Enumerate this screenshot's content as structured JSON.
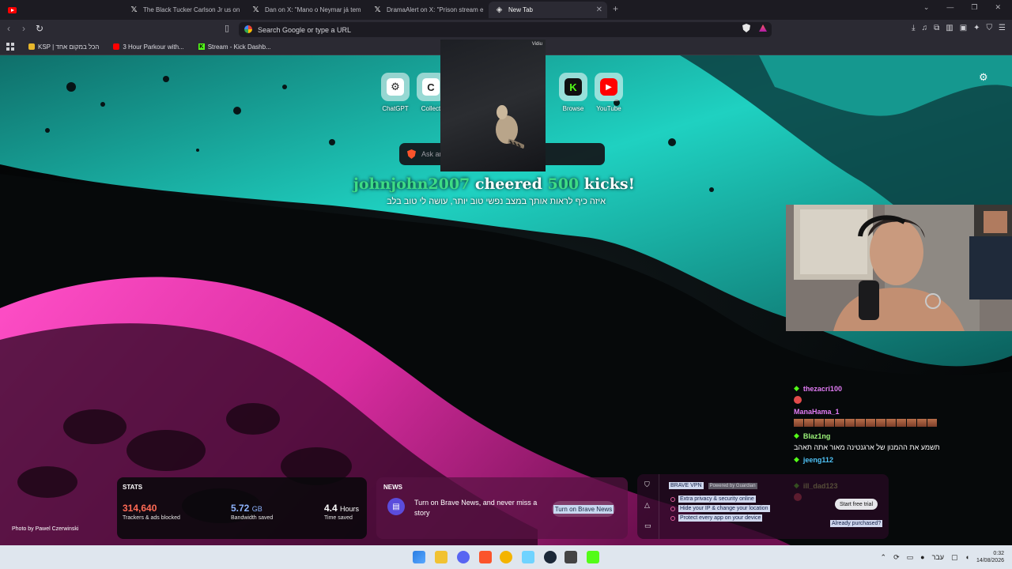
{
  "tabs": [
    {
      "title": "",
      "icon": "youtube-icon"
    },
    {
      "title": "The Black Tucker Carlson Jr us on X",
      "icon": "x-icon"
    },
    {
      "title": "Dan on X: \"Mano o Neymar já tem ta",
      "icon": "x-icon"
    },
    {
      "title": "DramaAlert on X: \"Prison stream end",
      "icon": "x-icon"
    },
    {
      "title": "New Tab",
      "icon": "brave-icon"
    }
  ],
  "omnibox": {
    "placeholder": "Search Google or type a URL"
  },
  "bookmarks": [
    {
      "label": "KSP | הכל במקום אחד",
      "icon": "ksp-icon"
    },
    {
      "label": "3 Hour Parkour with...",
      "icon": "youtube-icon"
    },
    {
      "label": "Stream - Kick Dashb...",
      "icon": "kick-icon"
    }
  ],
  "top_sites": [
    {
      "label": "ChatGPT",
      "glyph": "⚙"
    },
    {
      "label": "Collect",
      "glyph": "C"
    },
    {
      "label": "Browse",
      "glyph": "K"
    },
    {
      "label": "YouTube",
      "glyph": "▶"
    }
  ],
  "search": {
    "placeholder": "Ask ar"
  },
  "video_overlay": {
    "label": "Vidiu"
  },
  "cheer": {
    "user": "johnjohn2007",
    "verb": "cheered",
    "amount": "500",
    "unit": "kicks!",
    "message": "איזה כיף לראות אותך במצב נפשי טוב יותר, עושה לי טוב בלב"
  },
  "chat": {
    "users": [
      "thezacri100",
      "ManaHama_1",
      "Blaz1ng",
      "jeeng112",
      "ill_dad123"
    ],
    "message": "תשמע את ההמנון של ארגנטינה מאור אתה תאהב"
  },
  "stats": {
    "title": "STATS",
    "trackers_value": "314,640",
    "trackers_label": "Trackers & ads blocked",
    "bandwidth_value": "5.72",
    "bandwidth_unit": "GB",
    "bandwidth_label": "Bandwidth saved",
    "time_value": "4.4",
    "time_unit": "Hours",
    "time_label": "Time saved"
  },
  "news": {
    "title": "NEWS",
    "text": "Turn on Brave News, and never miss a story",
    "button": "Turn on Brave News"
  },
  "vpn": {
    "title": "BRAVE VPN",
    "powered": "Powered by Guardian",
    "features": [
      "Extra privacy & security online",
      "Hide your IP & change your location",
      "Protect every app on your device"
    ],
    "trial_button": "Start free trial",
    "purchased": "Already purchased?"
  },
  "photo_credit": "Photo by Pawel Czerwinski",
  "system": {
    "language": "עבר",
    "time": "0:32",
    "date": "14/08/2026"
  },
  "colors": {
    "accent_green": "#3ddc84",
    "kick_green": "#53fc18",
    "youtube_red": "#ff0000",
    "brave_orange": "#fb542b"
  }
}
